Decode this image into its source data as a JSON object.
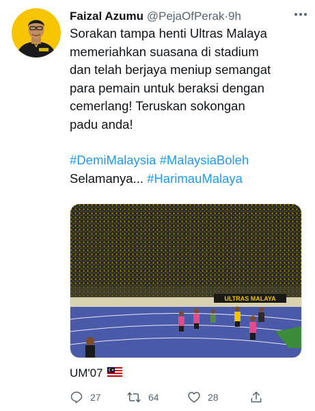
{
  "tweet": {
    "author_name": "Faizal Azumu",
    "handle": "@PejaOfPerak",
    "separator": "·",
    "time": "9h",
    "text_body": [
      "Sorakan tampa henti Ultras Malaya",
      "memeriahkan suasana di stadium",
      "dan telah berjaya meniup semangat",
      "para pemain untuk beraksi dengan",
      "cemerlang! Teruskan sokongan",
      "padu anda!"
    ],
    "hashtag_1": "#DemiMalaysia",
    "hashtag_2": "#MalaysiaBoleh",
    "selamanya": "Selamanya...",
    "hashtag_3": "#HarimauMalaya",
    "banner_text": "ULTRAS MALAYA",
    "footer_note": "UM'07"
  },
  "actions": {
    "replies": "27",
    "retweets": "64",
    "likes": "28"
  },
  "icons": [
    "more-icon",
    "reply-icon",
    "retweet-icon",
    "like-icon",
    "share-icon",
    "malaysia-flag-icon"
  ],
  "colors": {
    "accent": "#1d9bf0",
    "text": "#0f1419",
    "muted": "#536471",
    "crowd": "#2a2a1e",
    "jersey_yellow": "#f2c200",
    "track": "#4a5aa8",
    "pitch": "#3c8c3c"
  }
}
